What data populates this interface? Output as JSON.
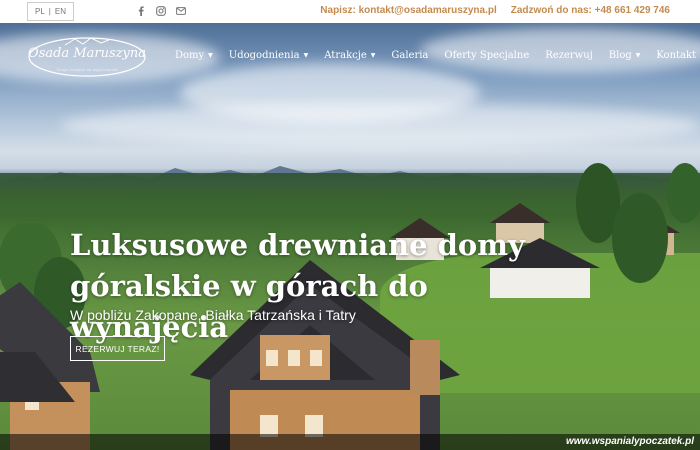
{
  "topbar": {
    "lang": [
      "PL",
      "EN"
    ],
    "social_icons": [
      "facebook-icon",
      "instagram-icon",
      "mail-icon"
    ],
    "email_text": "Napisz: kontakt@osadamaruszyna.pl",
    "phone_text": "Zadzwoń do nas: +48 661 429 746",
    "accent_color": "#c48a4e"
  },
  "logo": {
    "name": "Osada Maruszyna",
    "tagline": "Twoje miejsce na wypoczynek"
  },
  "nav": {
    "items": [
      {
        "label": "Domy",
        "dropdown": true
      },
      {
        "label": "Udogodnienia",
        "dropdown": true
      },
      {
        "label": "Atrakcje",
        "dropdown": true
      },
      {
        "label": "Galeria",
        "dropdown": false
      },
      {
        "label": "Oferty Specjalne",
        "dropdown": false
      },
      {
        "label": "Rezerwuj",
        "dropdown": false
      },
      {
        "label": "Blog",
        "dropdown": true
      },
      {
        "label": "Kontakt",
        "dropdown": true
      }
    ]
  },
  "hero": {
    "headline_line1": "Luksusowe drewniane domy",
    "headline_line2": "góralskie w górach do wynajęcia",
    "subline": "W pobliżu Zakopane, Białka Tatrzańska i Tatry",
    "cta_label": "REZERWUJ TERAZ!"
  },
  "watermark": "www.wspanialypoczatek.pl"
}
